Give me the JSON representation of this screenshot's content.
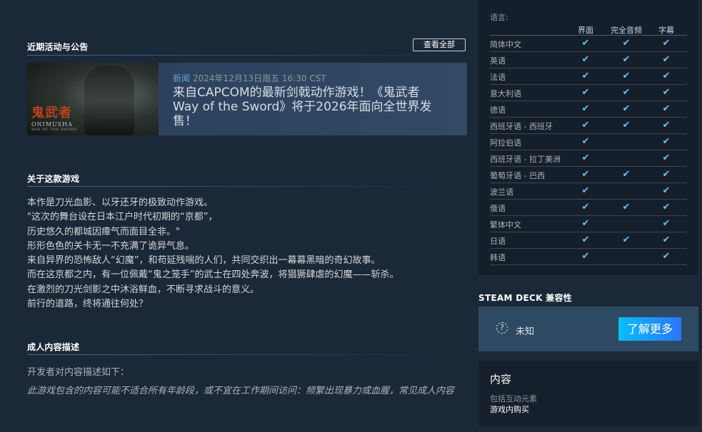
{
  "events": {
    "title": "近期活动与公告",
    "view_all": "查看全部",
    "news": {
      "tag": "新闻",
      "date": "2024年12月13日周五 16:30 CST",
      "headline": "来自CAPCOM的最新剑戟动作游戏！《鬼武者 Way of the Sword》将于2026年面向全世界发售！",
      "thumb_logo": "鬼武者",
      "thumb_latin": "ONIMUSHA",
      "thumb_sub": "WAY OF THE SWORD"
    }
  },
  "about": {
    "title": "关于这款游戏",
    "lines": [
      "本作是刀光血影、以牙还牙的极致动作游戏。",
      "\"这次的舞台设在日本江户时代初期的“京都”，",
      "历史悠久的都城因瘴气而面目全非。\"",
      "形形色色的关卡无一不充满了诡异气息。",
      "来自异界的恐怖敌人“幻魔”，和苟延残喘的人们，共同交织出一幕幕黑暗的奇幻故事。",
      "而在这京都之内，有一位佩戴“鬼之笼手”的武士在四处奔波，将猖獗肆虐的幻魔——斩杀。",
      "在激烈的刀光剑影之中沐浴鲜血，不断寻求战斗的意义。",
      "前行的道路，终将通往何处？"
    ]
  },
  "mature": {
    "title": "成人内容描述",
    "intro": "开发者对内容描述如下：",
    "desc": "此游戏包含的内容可能不适合所有年龄段，或不宜在工作期间访问：频繁出现暴力或血腥，常见成人内容"
  },
  "languages": {
    "label": "语言:",
    "columns": [
      "界面",
      "完全音频",
      "字幕"
    ],
    "check_glyph": "✔",
    "rows": [
      {
        "name": "简体中文",
        "ui": true,
        "audio": true,
        "subs": true
      },
      {
        "name": "英语",
        "ui": true,
        "audio": true,
        "subs": true
      },
      {
        "name": "法语",
        "ui": true,
        "audio": true,
        "subs": true
      },
      {
        "name": "意大利语",
        "ui": true,
        "audio": true,
        "subs": true
      },
      {
        "name": "德语",
        "ui": true,
        "audio": true,
        "subs": true
      },
      {
        "name": "西班牙语 - 西班牙",
        "ui": true,
        "audio": true,
        "subs": true
      },
      {
        "name": "阿拉伯语",
        "ui": true,
        "audio": false,
        "subs": true
      },
      {
        "name": "西班牙语 - 拉丁美洲",
        "ui": true,
        "audio": false,
        "subs": true
      },
      {
        "name": "葡萄牙语 - 巴西",
        "ui": true,
        "audio": true,
        "subs": true
      },
      {
        "name": "波兰语",
        "ui": true,
        "audio": false,
        "subs": true
      },
      {
        "name": "俄语",
        "ui": true,
        "audio": true,
        "subs": true
      },
      {
        "name": "繁体中文",
        "ui": true,
        "audio": false,
        "subs": true
      },
      {
        "name": "日语",
        "ui": true,
        "audio": true,
        "subs": true
      },
      {
        "name": "韩语",
        "ui": true,
        "audio": false,
        "subs": true
      }
    ]
  },
  "steam_deck": {
    "title": "STEAM DECK 兼容性",
    "icon": "question-circle-icon",
    "status": "未知",
    "learn_more": "了解更多"
  },
  "content": {
    "title": "内容",
    "line1": "包括互动元素",
    "line2": "游戏内购买"
  },
  "colors": {
    "background": "#1b2838",
    "accent_blue": "#66c0f4",
    "button_gradient_start": "#06bfff",
    "button_gradient_end": "#2d73ff"
  }
}
